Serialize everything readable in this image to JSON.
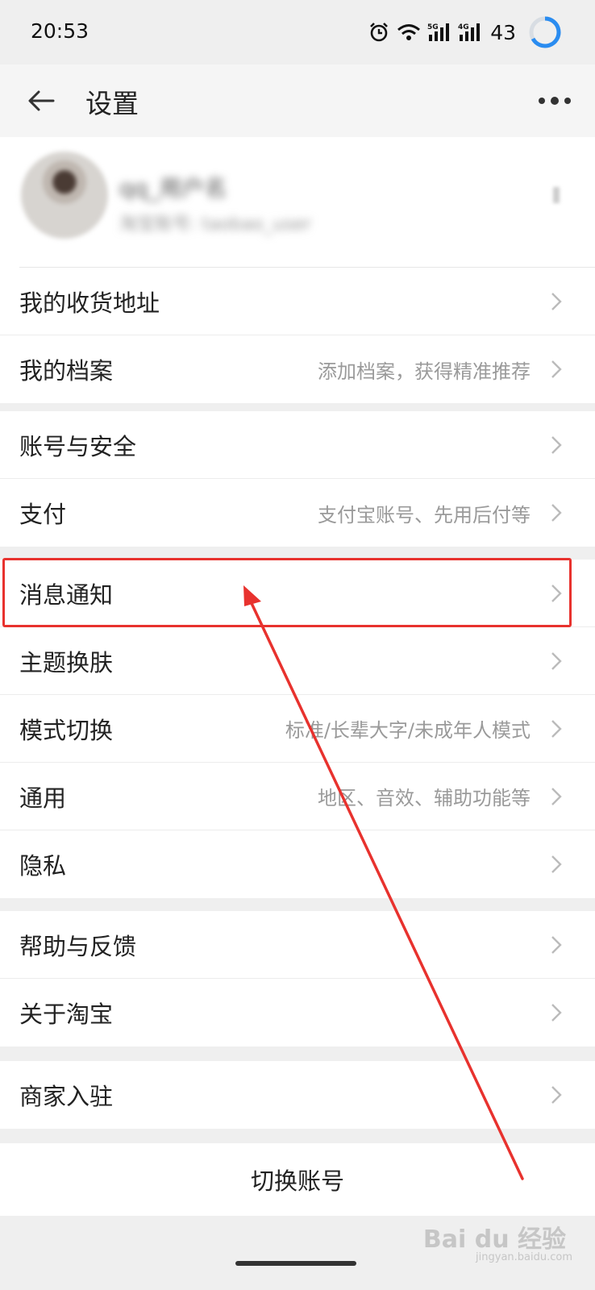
{
  "status_bar": {
    "time": "20:53",
    "battery": "43"
  },
  "nav": {
    "title": "设置"
  },
  "profile": {
    "name": "qq_用户名",
    "subtitle": "淘宝账号: taobao_user"
  },
  "groups": [
    {
      "rows": [
        {
          "label": "我的收货地址",
          "subtitle": ""
        },
        {
          "label": "我的档案",
          "subtitle": "添加档案，获得精准推荐"
        }
      ]
    },
    {
      "rows": [
        {
          "label": "账号与安全",
          "subtitle": ""
        },
        {
          "label": "支付",
          "subtitle": "支付宝账号、先用后付等"
        }
      ]
    },
    {
      "rows": [
        {
          "label": "消息通知",
          "subtitle": ""
        },
        {
          "label": "主题换肤",
          "subtitle": ""
        },
        {
          "label": "模式切换",
          "subtitle": "标准/长辈大字/未成年人模式"
        },
        {
          "label": "通用",
          "subtitle": "地区、音效、辅助功能等"
        },
        {
          "label": "隐私",
          "subtitle": ""
        }
      ]
    },
    {
      "rows": [
        {
          "label": "帮助与反馈",
          "subtitle": ""
        },
        {
          "label": "关于淘宝",
          "subtitle": ""
        }
      ]
    },
    {
      "rows": [
        {
          "label": "商家入驻",
          "subtitle": ""
        }
      ]
    }
  ],
  "switch_account": {
    "label": "切换账号"
  },
  "annotation": {
    "color": "#e8322e",
    "highlighted_item": "消息通知"
  },
  "watermark": {
    "text": "Bai du 经验",
    "sub": "jingyan.baidu.com"
  },
  "icons": [
    "alarm-icon",
    "wifi-icon",
    "signal-5g-icon",
    "signal-4g-icon",
    "battery-ring-icon",
    "back-arrow-icon",
    "more-icon",
    "chevron-right-icon"
  ]
}
